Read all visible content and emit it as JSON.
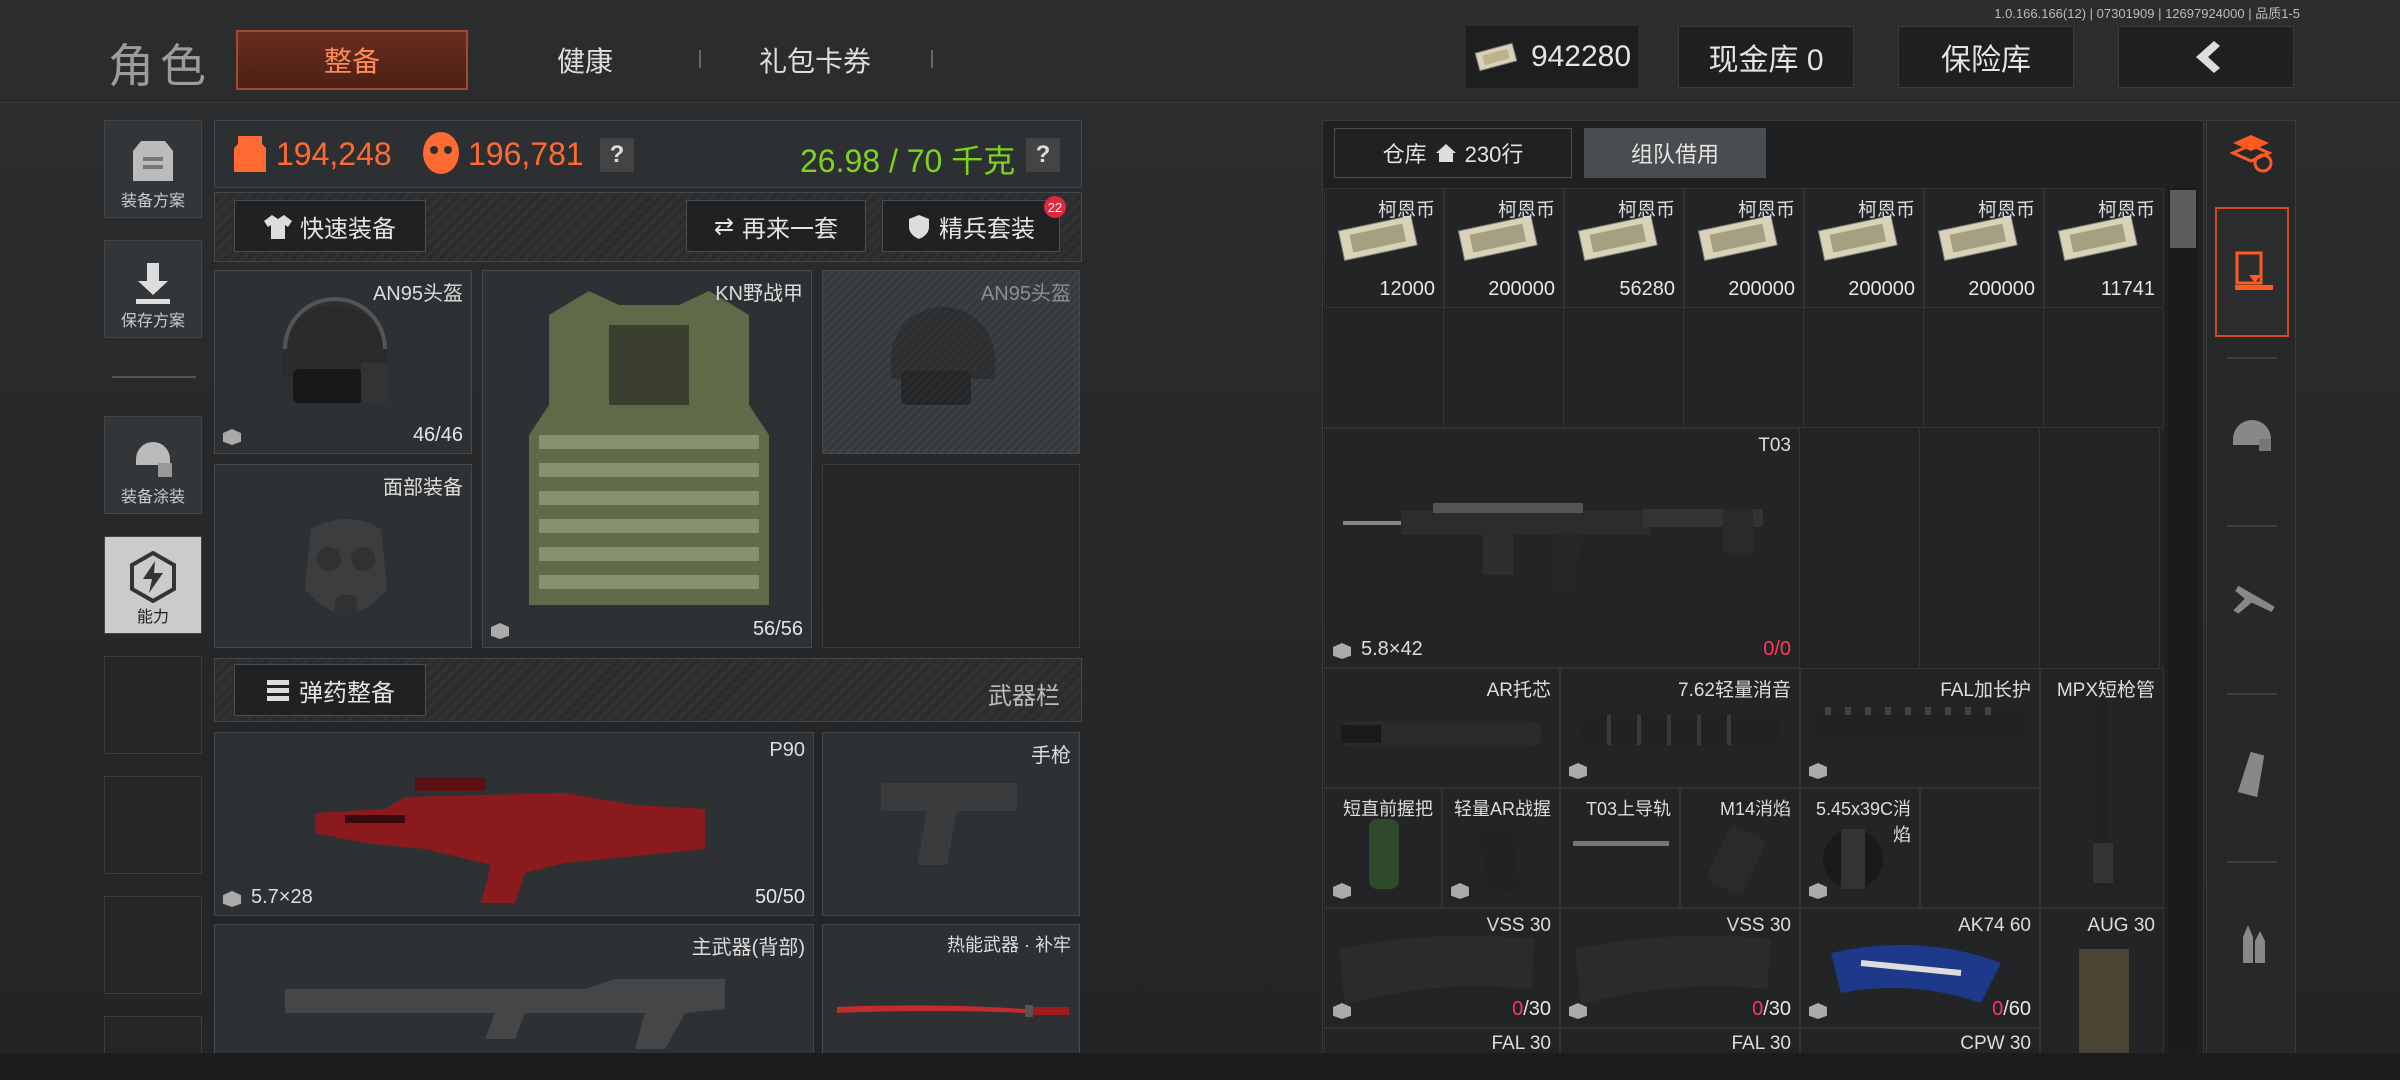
{
  "header": {
    "title": "角色",
    "tabs": [
      {
        "label": "整备",
        "active": true
      },
      {
        "label": "健康"
      },
      {
        "label": "礼包卡券"
      }
    ],
    "money": "942280",
    "cash_vault": "现金库 0",
    "safe": "保险库",
    "version": "1.0.166.166(12) | 07301909 | 12697924000 | 品质1-5"
  },
  "sidebar": [
    {
      "label": "装备方案",
      "icon": "loadout-icon"
    },
    {
      "label": "保存方案",
      "icon": "save-download-icon"
    },
    {
      "label": "装备涂装",
      "icon": "helmet-skin-icon"
    },
    {
      "label": "能力",
      "icon": "ability-icon",
      "active": true
    }
  ],
  "stats": {
    "value1": "194,248",
    "value2": "196,781",
    "weight": "26.98 / 70 千克",
    "help": "?"
  },
  "actions": {
    "quick": "快速装备",
    "again": "再来一套",
    "elite": "精兵套装",
    "elite_badge": "22",
    "ammo": "弹药整备",
    "weapon_bar": "武器栏"
  },
  "gear": {
    "helmet": {
      "label": "AN95头盔",
      "count": "46/46"
    },
    "vest": {
      "label": "KN野战甲",
      "count": "56/56"
    },
    "helmet2": {
      "label": "AN95头盔"
    },
    "face": {
      "label": "面部装备"
    },
    "primary": {
      "label": "P90",
      "ammo": "5.7×28",
      "count": "50/50"
    },
    "pistol": {
      "label": "手枪"
    },
    "backup": {
      "label": "主武器(背部)"
    },
    "melee": {
      "label": "热能武器 · 补牢"
    }
  },
  "warehouse": {
    "tab1": "仓库",
    "rows": "230行",
    "tab2": "组队借用",
    "cash": [
      {
        "name": "柯恩币",
        "amount": "12000"
      },
      {
        "name": "柯恩币",
        "amount": "200000"
      },
      {
        "name": "柯恩币",
        "amount": "56280"
      },
      {
        "name": "柯恩币",
        "amount": "200000"
      },
      {
        "name": "柯恩币",
        "amount": "200000"
      },
      {
        "name": "柯恩币",
        "amount": "200000"
      },
      {
        "name": "柯恩币",
        "amount": "11741"
      }
    ],
    "t03": {
      "label": "T03",
      "ammo": "5.8×42",
      "count_cur": "0",
      "count_max": "/0"
    },
    "row2": [
      {
        "label": "AR托芯"
      },
      {
        "label": "7.62轻量消音"
      },
      {
        "label": "FAL加长护"
      },
      {
        "label": "MPX短枪管"
      }
    ],
    "row3": [
      {
        "label": "短直前握把"
      },
      {
        "label": "轻量AR战握"
      },
      {
        "label": "T03上导轨"
      },
      {
        "label": "M14消焰"
      },
      {
        "label": "5.45x39C消焰"
      }
    ],
    "mags": [
      {
        "label": "VSS 30",
        "cur": "0",
        "max": "/30"
      },
      {
        "label": "VSS 30",
        "cur": "0",
        "max": "/30"
      },
      {
        "label": "AK74 60",
        "cur": "0",
        "max": "/60"
      },
      {
        "label": "AUG 30"
      }
    ],
    "next": [
      {
        "label": "FAL 30"
      },
      {
        "label": "FAL 30"
      },
      {
        "label": "CPW 30"
      }
    ]
  }
}
